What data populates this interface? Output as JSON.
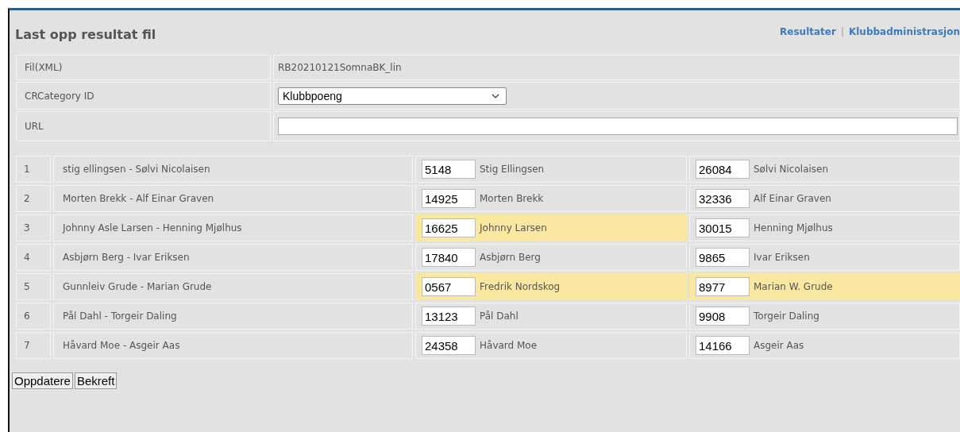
{
  "panel": {
    "title": "Last opp resultat fil",
    "links": [
      "Resultater",
      "Klubbadministrasjon"
    ],
    "link_separator": "|"
  },
  "form": [
    {
      "label": "Fil(XML)",
      "kind": "text",
      "value": "RB20210121SomnaBK_lin"
    },
    {
      "label": "CRCategory ID",
      "kind": "select",
      "value": "Klubbpoeng"
    },
    {
      "label": "URL",
      "kind": "input"
    }
  ],
  "rows": [
    {
      "number": "1",
      "pair": "stig ellingsen - Sølvi Nicolaisen",
      "runners": [
        {
          "id": "5148",
          "name": "Stig Ellingsen",
          "highlighted": false
        },
        {
          "id": "26084",
          "name": "Sølvi Nicolaisen",
          "highlighted": false
        }
      ]
    },
    {
      "number": "2",
      "pair": "Morten Brekk - Alf Einar Graven",
      "runners": [
        {
          "id": "14925",
          "name": "Morten Brekk",
          "highlighted": false
        },
        {
          "id": "32336",
          "name": "Alf Einar Graven",
          "highlighted": false
        }
      ]
    },
    {
      "number": "3",
      "pair": "Johnny Asle Larsen - Henning Mjølhus",
      "runners": [
        {
          "id": "16625",
          "name": "Johnny Larsen",
          "highlighted": true
        },
        {
          "id": "30015",
          "name": "Henning Mjølhus",
          "highlighted": false
        }
      ]
    },
    {
      "number": "4",
      "pair": "Asbjørn Berg - Ivar Eriksen",
      "runners": [
        {
          "id": "17840",
          "name": "Asbjørn Berg",
          "highlighted": false
        },
        {
          "id": "9865",
          "name": "Ivar Eriksen",
          "highlighted": false
        }
      ]
    },
    {
      "number": "5",
      "pair": "Gunnleiv Grude - Marian Grude",
      "runners": [
        {
          "id": "0567",
          "name": "Fredrik Nordskog",
          "highlighted": true
        },
        {
          "id": "8977",
          "name": "Marian W. Grude",
          "highlighted": true
        }
      ]
    },
    {
      "number": "6",
      "pair": "Pål Dahl - Torgeir Daling",
      "runners": [
        {
          "id": "13123",
          "name": "Pål Dahl",
          "highlighted": false
        },
        {
          "id": "9908",
          "name": "Torgeir Daling",
          "highlighted": false
        }
      ]
    },
    {
      "number": "7",
      "pair": "Håvard Moe - Asgeir Aas",
      "runners": [
        {
          "id": "24358",
          "name": "Håvard Moe",
          "highlighted": false
        },
        {
          "id": "14166",
          "name": "Asgeir Aas",
          "highlighted": false
        }
      ]
    }
  ],
  "buttons": [
    "Oppdatere",
    "Bekreft"
  ]
}
